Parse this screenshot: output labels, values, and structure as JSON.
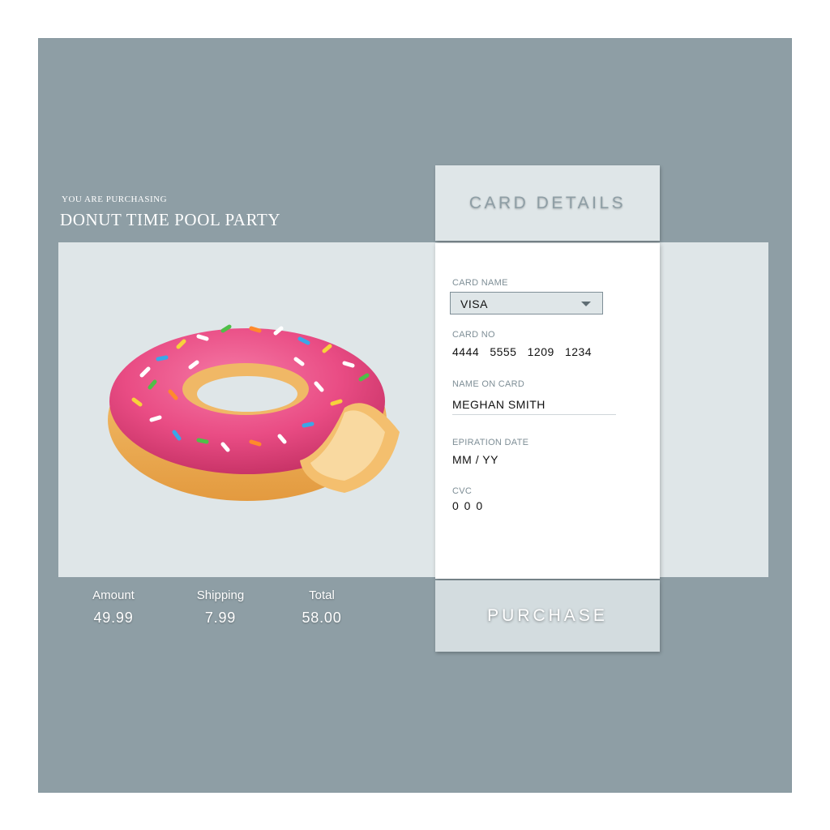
{
  "product": {
    "purchasing_label": "YOU ARE PURCHASING",
    "title": "DONUT TIME POOL PARTY",
    "image_icon": "donut-pool-float"
  },
  "card": {
    "header": "CARD DETAILS",
    "card_name_label": "CARD NAME",
    "card_name_value": "VISA",
    "card_no_label": "CARD NO",
    "card_no_value": "4444   5555   1209   1234",
    "name_on_card_label": "NAME ON CARD",
    "name_on_card_value": "MEGHAN SMITH",
    "expiration_label": "EPIRATION DATE",
    "expiration_value": "MM / YY",
    "cvc_label": "CVC",
    "cvc_value": "0 0 0"
  },
  "summary": {
    "amount_label": "Amount",
    "amount_value": "49.99",
    "shipping_label": "Shipping",
    "shipping_value": "7.99",
    "total_label": "Total",
    "total_value": "58.00"
  },
  "actions": {
    "purchase_label": "PURCHASE"
  },
  "colors": {
    "background": "#8e9ea5",
    "panel": "#dfe6e8",
    "donut_icing": "#ea4f86",
    "donut_dough": "#f2b45c"
  }
}
